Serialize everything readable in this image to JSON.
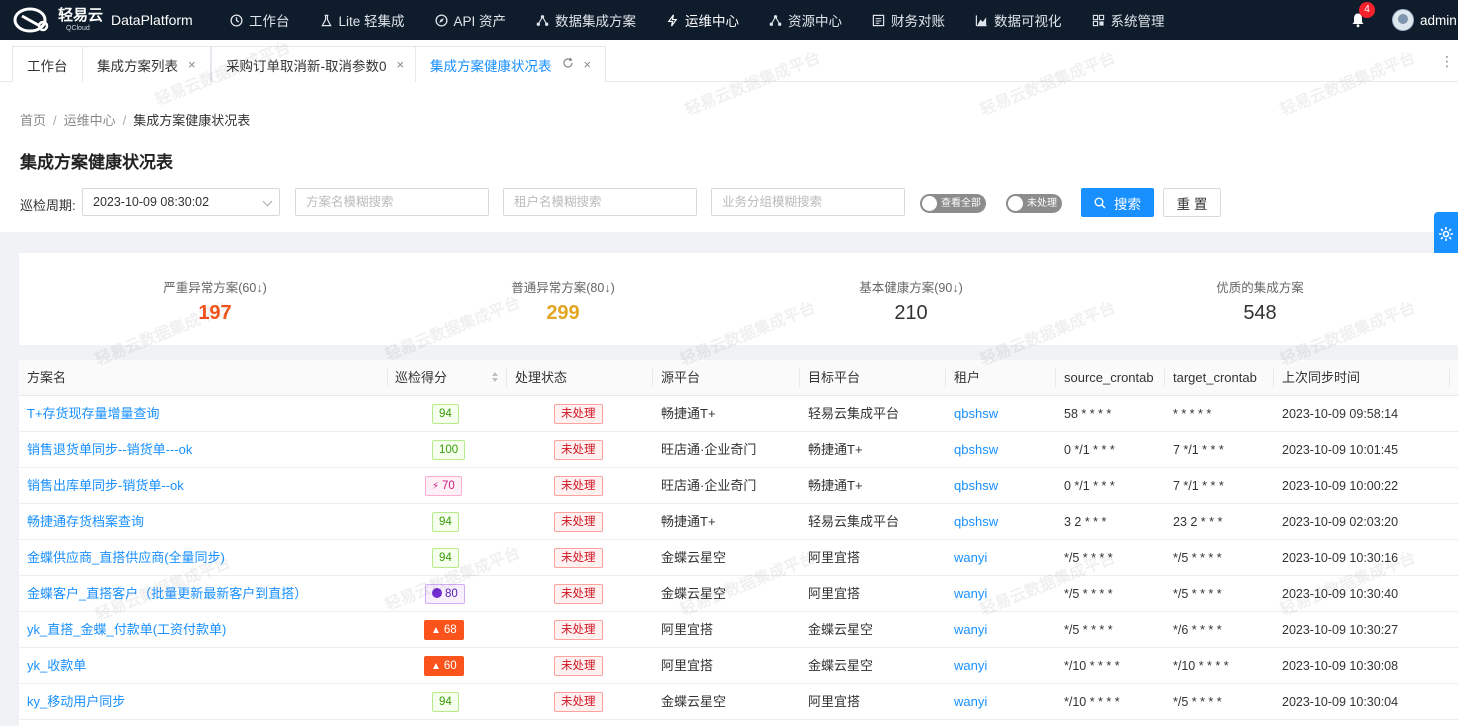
{
  "app": {
    "logo_cn": "轻易云",
    "logo_en": "QCloud",
    "brand": "DataPlatform",
    "nav": [
      {
        "label": "工作台",
        "icon": "clock-icon"
      },
      {
        "label": "Lite 轻集成",
        "icon": "flask-icon"
      },
      {
        "label": "API 资产",
        "icon": "compass-icon"
      },
      {
        "label": "数据集成方案",
        "icon": "network-icon"
      },
      {
        "label": "运维中心",
        "icon": "bolt-icon"
      },
      {
        "label": "资源中心",
        "icon": "network-icon"
      },
      {
        "label": "财务对账",
        "icon": "ledger-icon"
      },
      {
        "label": "数据可视化",
        "icon": "chart-icon"
      },
      {
        "label": "系统管理",
        "icon": "grid-icon"
      }
    ],
    "notification_count": "4",
    "user": "admin"
  },
  "tabs": [
    {
      "label": "工作台"
    },
    {
      "label": "集成方案列表"
    },
    {
      "label": "采购订单取消新-取消参数0"
    },
    {
      "label": "集成方案健康状况表"
    }
  ],
  "breadcrumb": [
    "首页",
    "运维中心",
    "集成方案健康状况表"
  ],
  "page_title": "集成方案健康状况表",
  "filters": {
    "period_label": "巡检周期:",
    "period_value": "2023-10-09 08:30:02",
    "scheme_placeholder": "方案名模糊搜索",
    "tenant_placeholder": "租户名模糊搜索",
    "group_placeholder": "业务分组模糊搜索",
    "toggle_all": "查看全部",
    "toggle_unhandled": "未处理",
    "search_label": "搜索",
    "reset_label": "重 置"
  },
  "stats": [
    {
      "label": "严重异常方案(60↓)",
      "value": "197",
      "color": "#f5541b"
    },
    {
      "label": "普通异常方案(80↓)",
      "value": "299",
      "color": "#e2a622"
    },
    {
      "label": "基本健康方案(90↓)",
      "value": "210",
      "color": "#333333"
    },
    {
      "label": "优质的集成方案",
      "value": "548",
      "color": "#333333"
    }
  ],
  "table": {
    "columns": [
      "方案名",
      "巡检得分",
      "处理状态",
      "源平台",
      "目标平台",
      "租户",
      "source_crontab",
      "target_crontab",
      "上次同步时间"
    ],
    "rows": [
      {
        "name": "T+存货现存量增量查询",
        "score": "94",
        "score_style": "green",
        "status": "未处理",
        "source": "畅捷通T+",
        "target": "轻易云集成平台",
        "tenant": "qbshsw",
        "source_crontab": "58 * * * *",
        "target_crontab": "* * * * *",
        "last_sync": "2023-10-09 09:58:14"
      },
      {
        "name": "销售退货单同步--销货单---ok",
        "score": "100",
        "score_style": "green",
        "status": "未处理",
        "source": "旺店通·企业奇门",
        "target": "畅捷通T+",
        "tenant": "qbshsw",
        "source_crontab": "0 */1 * * *",
        "target_crontab": "7 */1 * * *",
        "last_sync": "2023-10-09 10:01:45"
      },
      {
        "name": "销售出库单同步-销货单--ok",
        "score": "70",
        "score_style": "pink",
        "status": "未处理",
        "source": "旺店通·企业奇门",
        "target": "畅捷通T+",
        "tenant": "qbshsw",
        "source_crontab": "0 */1 * * *",
        "target_crontab": "7 */1 * * *",
        "last_sync": "2023-10-09 10:00:22"
      },
      {
        "name": "畅捷通存货档案查询",
        "score": "94",
        "score_style": "green",
        "status": "未处理",
        "source": "畅捷通T+",
        "target": "轻易云集成平台",
        "tenant": "qbshsw",
        "source_crontab": "3 2 * * *",
        "target_crontab": "23 2 * * *",
        "last_sync": "2023-10-09 02:03:20"
      },
      {
        "name": "金蝶供应商_直搭供应商(全量同步)",
        "score": "94",
        "score_style": "green",
        "status": "未处理",
        "source": "金蝶云星空",
        "target": "阿里宜搭",
        "tenant": "wanyi",
        "source_crontab": "*/5 * * * *",
        "target_crontab": "*/5 * * * *",
        "last_sync": "2023-10-09 10:30:16"
      },
      {
        "name": "金蝶客户_直搭客户（批量更新最新客户到直搭）",
        "score": "80",
        "score_style": "purple",
        "status": "未处理",
        "source": "金蝶云星空",
        "target": "阿里宜搭",
        "tenant": "wanyi",
        "source_crontab": "*/5 * * * *",
        "target_crontab": "*/5 * * * *",
        "last_sync": "2023-10-09 10:30:40"
      },
      {
        "name": "yk_直搭_金蝶_付款单(工资付款单)",
        "score": "68",
        "score_style": "orange",
        "status": "未处理",
        "source": "阿里宜搭",
        "target": "金蝶云星空",
        "tenant": "wanyi",
        "source_crontab": "*/5 * * * *",
        "target_crontab": "*/6 * * * *",
        "last_sync": "2023-10-09 10:30:27"
      },
      {
        "name": "yk_收款单",
        "score": "60",
        "score_style": "orange",
        "status": "未处理",
        "source": "阿里宜搭",
        "target": "金蝶云星空",
        "tenant": "wanyi",
        "source_crontab": "*/10 * * * *",
        "target_crontab": "*/10 * * * *",
        "last_sync": "2023-10-09 10:30:08"
      },
      {
        "name": "ky_移动用户同步",
        "score": "94",
        "score_style": "green",
        "status": "未处理",
        "source": "金蝶云星空",
        "target": "阿里宜搭",
        "tenant": "wanyi",
        "source_crontab": "*/10 * * * *",
        "target_crontab": "*/5 * * * *",
        "last_sync": "2023-10-09 10:30:04"
      }
    ]
  },
  "watermark": "轻易云数据集成平台",
  "colors": {
    "nav_bg": "#0f1c2b",
    "accent": "#1890ff",
    "danger": "#cf1322"
  }
}
